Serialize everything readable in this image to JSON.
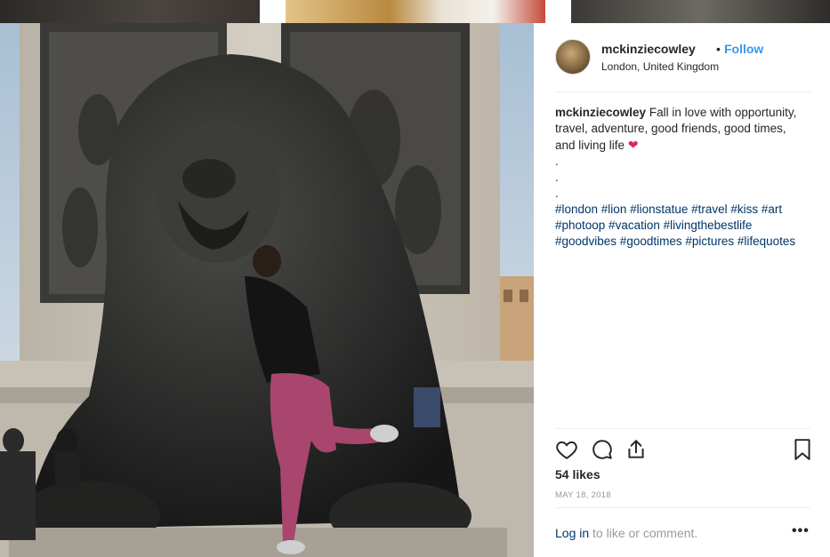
{
  "post": {
    "username": "mckinziecowley",
    "separator": "•",
    "follow_label": "Follow",
    "location": "London, United Kingdom",
    "caption": {
      "username": "mckinziecowley",
      "text_line1": "Fall in love with opportunity,",
      "text_line2": "travel, adventure, good friends, good times,",
      "text_line3": "and living life",
      "emoji": "❤",
      "dots": [
        ".",
        ".",
        "."
      ],
      "hashtags_line1": "#london #lion #lionstatue #travel #kiss #art",
      "hashtags_line2": "#photoop #vacation #livingthebestlife",
      "hashtags_line3": "#goodvibes #goodtimes #pictures #lifequotes"
    },
    "likes": "54 likes",
    "date": "MAY 18, 2018",
    "login_link": "Log in",
    "login_rest": " to like or comment.",
    "more_label": "•••"
  },
  "icons": {
    "like": "heart-outline-icon",
    "comment": "comment-bubble-icon",
    "share": "share-upload-icon",
    "save": "bookmark-icon",
    "avatar": "user-avatar",
    "heart_emoji": "red-heart-emoji"
  },
  "colors": {
    "follow": "#3897f0",
    "hashtag": "#003569",
    "muted": "#999999",
    "text": "#262626",
    "heart": "#e0245e"
  }
}
